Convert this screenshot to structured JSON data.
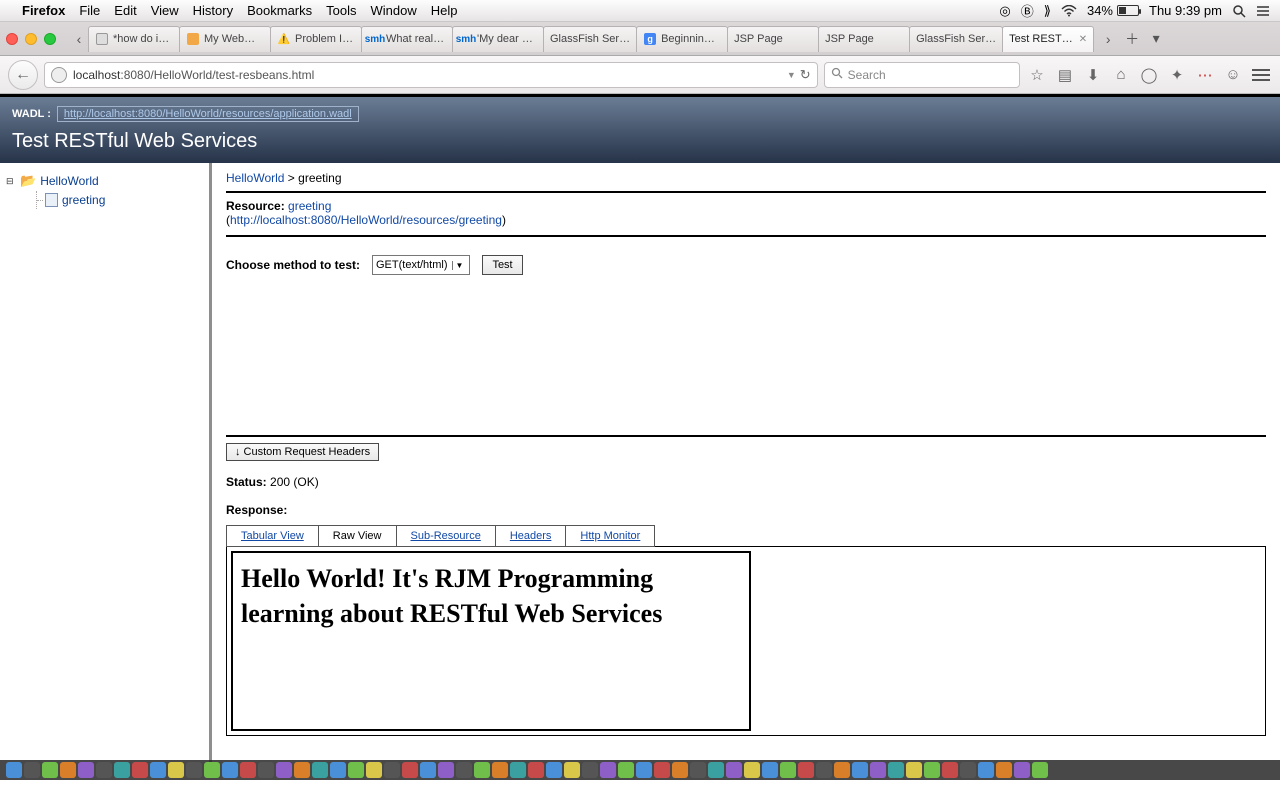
{
  "menubar": {
    "app": "Firefox",
    "items": [
      "File",
      "Edit",
      "View",
      "History",
      "Bookmarks",
      "Tools",
      "Window",
      "Help"
    ],
    "battery_pct": "34%",
    "clock": "Thu 9:39 pm"
  },
  "tabs": [
    {
      "label": "*how do i…",
      "fav": "box"
    },
    {
      "label": "My Web…",
      "fav": "amz"
    },
    {
      "label": "Problem I…",
      "fav": "warn"
    },
    {
      "label": "What real…",
      "fav": "smh"
    },
    {
      "label": "'My dear …",
      "fav": "smh"
    },
    {
      "label": "GlassFish Ser…",
      "fav": ""
    },
    {
      "label": "Beginnin…",
      "fav": "ggl"
    },
    {
      "label": "JSP Page",
      "fav": ""
    },
    {
      "label": "JSP Page",
      "fav": ""
    },
    {
      "label": "GlassFish Ser…",
      "fav": ""
    },
    {
      "label": "Test REST…",
      "fav": "",
      "active": true
    }
  ],
  "url": {
    "host": "localhost",
    "port": ":8080",
    "path": "/HelloWorld/test-resbeans.html"
  },
  "search_placeholder": "Search",
  "page": {
    "wadl_label": "WADL :",
    "wadl_url": "http://localhost:8080/HelloWorld/resources/application.wadl",
    "title": "Test RESTful Web Services",
    "tree": {
      "root": "HelloWorld",
      "child": "greeting"
    },
    "crumb_root": "HelloWorld",
    "crumb_sep": " > ",
    "crumb_leaf": "greeting",
    "resource_label": "Resource:",
    "resource_name": "greeting",
    "resource_url": "http://localhost:8080/HelloWorld/resources/greeting",
    "method_label": "Choose method to test:",
    "method_value": "GET(text/html)",
    "test_btn": "Test",
    "hdr_btn": "↓ Custom Request Headers",
    "status_label": "Status:",
    "status_value": "200 (OK)",
    "response_label": "Response:",
    "resp_tabs": [
      "Tabular View",
      "Raw View",
      "Sub-Resource",
      "Headers",
      "Http Monitor"
    ],
    "resp_active": 1,
    "resp_body": "Hello World! It's RJM Programming learning about RESTful Web Services"
  },
  "dock_colors": [
    "#4a90d9",
    "#555",
    "#6fbf4a",
    "#d97f2a",
    "#8e60c7",
    "#555",
    "#3aa0a0",
    "#c74a4a",
    "#4a90d9",
    "#d9c74a",
    "#555",
    "#6fbf4a",
    "#4a90d9",
    "#c74a4a",
    "#555",
    "#8e60c7",
    "#d97f2a",
    "#3aa0a0",
    "#4a90d9",
    "#6fbf4a",
    "#d9c74a",
    "#555",
    "#c74a4a",
    "#4a90d9",
    "#8e60c7",
    "#555",
    "#6fbf4a",
    "#d97f2a",
    "#3aa0a0",
    "#c74a4a",
    "#4a90d9",
    "#d9c74a",
    "#555",
    "#8e60c7",
    "#6fbf4a",
    "#4a90d9",
    "#c74a4a",
    "#d97f2a",
    "#555",
    "#3aa0a0",
    "#8e60c7",
    "#d9c74a",
    "#4a90d9",
    "#6fbf4a",
    "#c74a4a",
    "#555",
    "#d97f2a",
    "#4a90d9",
    "#8e60c7",
    "#3aa0a0",
    "#d9c74a",
    "#6fbf4a",
    "#c74a4a",
    "#555",
    "#4a90d9",
    "#d97f2a",
    "#8e60c7",
    "#6fbf4a"
  ]
}
